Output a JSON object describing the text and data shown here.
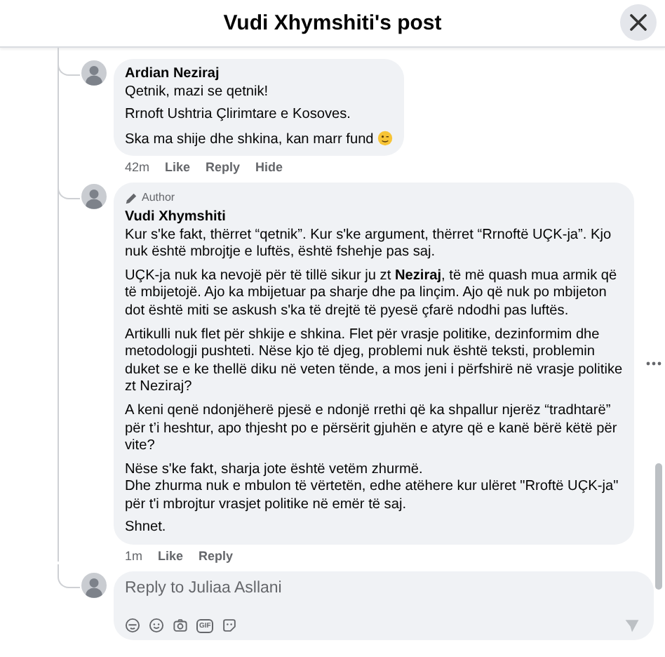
{
  "header": {
    "title": "Vudi Xhymshiti's post"
  },
  "comments": [
    {
      "author": "Ardian Neziraj",
      "paragraphs": [
        "Qetnik, mazi se qetnik!",
        "Rrnoft Ushtria Çlirimtare e Kosoves.",
        "Ska ma shije dhe shkina, kan marr fund"
      ],
      "ends_with_emoji": true,
      "time": "42m",
      "actions": [
        "Like",
        "Reply",
        "Hide"
      ],
      "has_menu": false
    },
    {
      "author": "Vudi Xhymshiti",
      "author_badge": "Author",
      "paragraphs": [
        "Kur s'ke fakt, thërret “qetnik”. Kur s'ke argument, thërret “Rrnoftë UÇK-ja”. Kjo nuk është mbrojtje e luftës, është fshehje pas saj.",
        "UÇK-ja nuk ka nevojë për të tillë sikur ju zt **Neziraj**, të më quash mua armik që të mbijetojë. Ajo ka mbijetuar pa sharje dhe pa linçim. Ajo që nuk po mbijeton dot është miti se askush s'ka të drejtë të pyesë çfarë ndodhi pas luftës.",
        "Artikulli nuk flet për shkije e shkina. Flet për vrasje politike, dezinformim dhe metodologji pushteti. Nëse kjo të djeg, problemi nuk është teksti, problemin duket se e ke thellë diku në veten tënde, a mos jeni i përfshirë në vrasje politike zt Neziraj?",
        "A keni qenë ndonjëherë pjesë e ndonjë rrethi që ka shpallur njerëz “tradhtarë” për t’i heshtur, apo thjesht po e përsërit gjuhën e atyre që e kanë bërë këtë për vite?",
        "Nëse s'ke fakt, sharja jote është vetëm zhurmë.\nDhe zhurma nuk e mbulon të vërtetën, edhe atëhere kur ulëret \"Rroftë UÇK-ja\" për t'i mbrojtur vrasjet politike në emër të saj.",
        "Shnet."
      ],
      "ends_with_emoji": false,
      "time": "1m",
      "actions": [
        "Like",
        "Reply"
      ],
      "has_menu": true
    }
  ],
  "reply_box": {
    "placeholder": "Reply to Juliaa Asllani",
    "gif_label": "GIF"
  }
}
